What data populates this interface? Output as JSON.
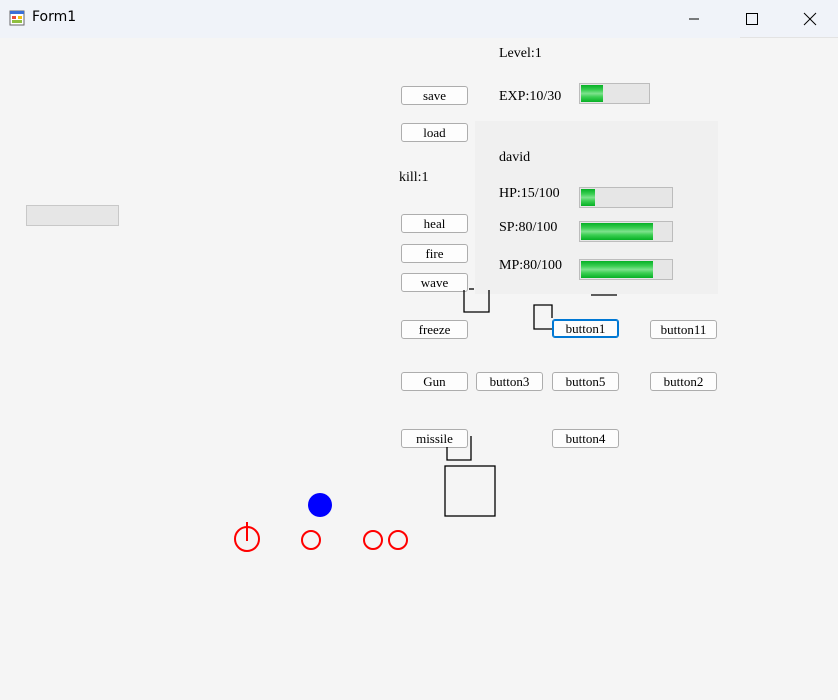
{
  "window": {
    "title": "Form1"
  },
  "stats": {
    "level": "Level:1",
    "exp": "EXP:10/30",
    "exp_progress": 0.333,
    "kill": "kill:1"
  },
  "character": {
    "name": "david",
    "hp": "HP:15/100",
    "hp_progress": 0.15,
    "sp": "SP:80/100",
    "sp_progress": 0.8,
    "mp": "MP:80/100",
    "mp_progress": 0.8
  },
  "buttons": {
    "save": "save",
    "load": "load",
    "heal": "heal",
    "fire": "fire",
    "wave": "wave",
    "freeze": "freeze",
    "gun": "Gun",
    "missile": "missile",
    "button1": "button1",
    "button2": "button2",
    "button3": "button3",
    "button4": "button4",
    "button5": "button5",
    "button11": "button11"
  },
  "colors": {
    "progress_green": "#06b025",
    "player_dot": "#0000ff",
    "enemy_circle": "#ff0000",
    "focus_border": "#0078d4"
  },
  "icons": {
    "app": "form-app-icon",
    "minimize": "minimize-icon",
    "maximize": "maximize-icon",
    "close": "close-icon"
  }
}
